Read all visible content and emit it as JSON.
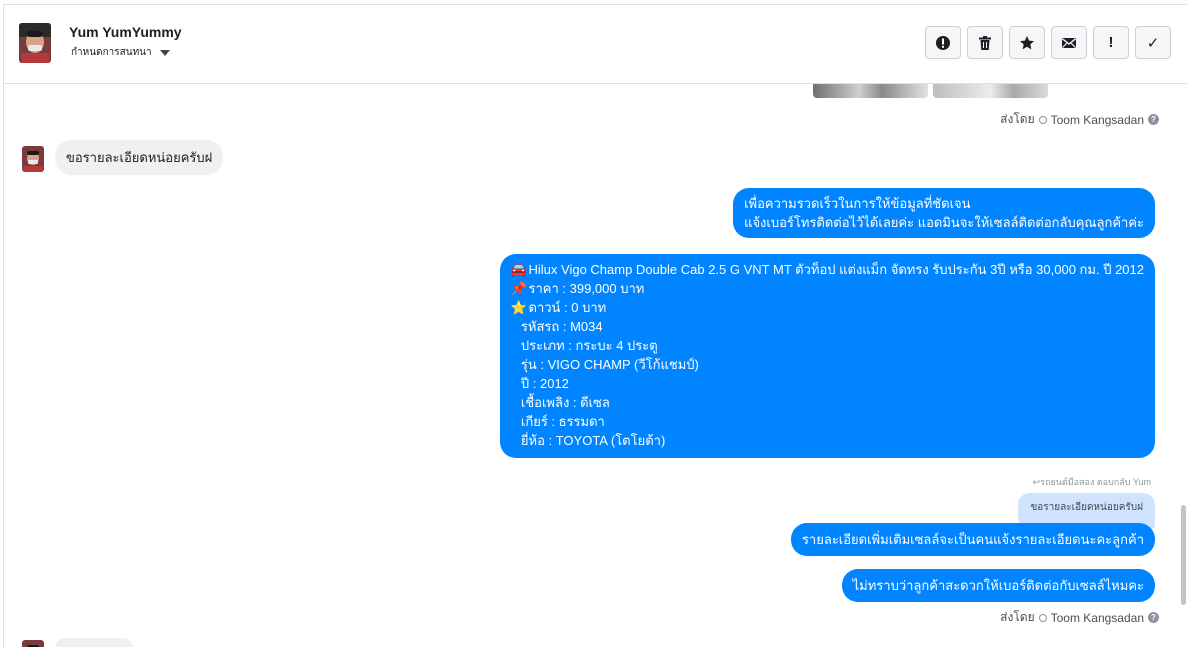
{
  "header": {
    "contact_name": "Yum YumYummy",
    "conversation_label": "กำหนดการสนทนา",
    "toolbar": [
      {
        "name": "spam-button",
        "icon": "alert-circle-icon"
      },
      {
        "name": "delete-button",
        "icon": "trash-icon"
      },
      {
        "name": "star-button",
        "icon": "star-icon"
      },
      {
        "name": "mark-unread-button",
        "icon": "envelope-icon"
      },
      {
        "name": "important-button",
        "icon": "exclamation-icon",
        "glyph": "!"
      },
      {
        "name": "done-button",
        "icon": "check-icon",
        "glyph": "✓"
      }
    ]
  },
  "thread": {
    "sent_by_prefix": "ส่งโดย",
    "sent_by_name_1": "Toom Kangsadan",
    "incoming_1": "ขอรายละเอียดหน่อยครับฝ",
    "outgoing_1": [
      "เพื่อความรวดเร็วในการให้ข้อมูลที่ชัดเจน",
      "แจ้งเบอร์โทรติดต่อไว้ได้เลยค่ะ แอดมินจะให้เซลล์ติดต่อกลับคุณลูกค้าค่ะ"
    ],
    "outgoing_2": [
      {
        "emoji": "🚘",
        "text": "Hilux Vigo Champ Double Cab 2.5 G VNT MT ตัวท็อป แต่งแม็ก จัดทรง รับประกัน 3ปี หรือ 30,000 กม. ปี 2012"
      },
      {
        "emoji": "📌",
        "text": "ราคา : 399,000 บาท"
      },
      {
        "emoji": "⭐",
        "text": "ดาวน์ : 0 บาท"
      },
      {
        "emoji": "",
        "text": "รหัสรถ : M034"
      },
      {
        "emoji": "",
        "text": "ประเภท : กระบะ 4 ประตู"
      },
      {
        "emoji": "",
        "text": "รุ่น : VIGO CHAMP (วีโก้แชมป์)"
      },
      {
        "emoji": "",
        "text": "ปี : 2012"
      },
      {
        "emoji": "",
        "text": "เชื้อเพลิง : ดีเซล"
      },
      {
        "emoji": "",
        "text": "เกียร์ : ธรรมดา"
      },
      {
        "emoji": "",
        "text": "ยี่ห้อ : TOYOTA (โตโยต้า)"
      }
    ],
    "reply_label": "รถยนต์มือสอง ตอบกลับ Yum",
    "reply_quote": "ขอรายละเอียดหน่อยครับฝ",
    "outgoing_3": "รายละเอียดเพิ่มเติมเซลล์จะเป็นคนแจ้งรายละเอียดนะคะลูกค้า",
    "outgoing_4": "ไม่ทราบว่าลูกค้าสะดวกให้เบอร์ติดต่อกับเซลล์ไหมคะ",
    "sent_by_name_2": "Toom Kangsadan"
  },
  "colors": {
    "outgoing_bubble": "#0084ff",
    "incoming_bubble": "#f0f0f0",
    "reply_quote": "#cfe3ff"
  }
}
